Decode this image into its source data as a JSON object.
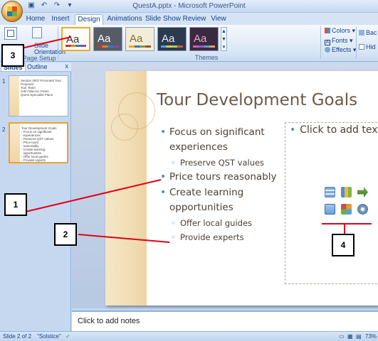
{
  "window": {
    "title": "QuestA.pptx - Microsoft PowerPoint",
    "qat_icons": [
      "save-icon",
      "undo-icon",
      "redo-icon",
      "customize-icon"
    ]
  },
  "tabs": [
    "Home",
    "Insert",
    "Design",
    "Animations",
    "Slide Show",
    "Review",
    "View"
  ],
  "active_tab": "Design",
  "ribbon": {
    "page_setup_group_label": "Page Setup",
    "slide_orientation_label": "Slide Orientation",
    "page_setup_label": "Page Setup",
    "themes_group_label": "Themes",
    "theme_thumb_text": "Aa",
    "colors_label": "Colors",
    "fonts_label": "Fonts",
    "effects_label": "Effects",
    "background_label": "Bac",
    "hide_label": "Hid"
  },
  "left_pane": {
    "tab_slides": "Slides",
    "tab_outline": "Outline",
    "close": "x",
    "thumbs": [
      {
        "num": "1",
        "text": "Section 2007 Promoted Tour\nProposal\nTour Team\nJohn Macron Green\nQuest Specialist Plans"
      },
      {
        "num": "2",
        "text": "Tour Development Goals\n- Focus on significant\n  experiences\n- Preserve QST values\n- Price tours\n  reasonably\n- Create learning\n  opportunities\n- Offer local guides\n- Provide experts"
      }
    ]
  },
  "slide": {
    "title": "Tour Development Goals",
    "bullets": [
      {
        "level": 1,
        "text": "Focus on significant experiences"
      },
      {
        "level": 2,
        "text": "Preserve QST values"
      },
      {
        "level": 1,
        "text": "Price tours reasonably"
      },
      {
        "level": 1,
        "text": "Create learning opportunities"
      },
      {
        "level": 2,
        "text": "Offer local guides"
      },
      {
        "level": 2,
        "text": "Provide experts"
      }
    ],
    "placeholder_text": "Click to add text",
    "placeholder_icons": [
      "insert-table-icon",
      "insert-chart-icon",
      "insert-smartart-icon",
      "insert-picture-icon",
      "insert-clipart-icon",
      "insert-media-icon"
    ]
  },
  "notes": {
    "placeholder": "Click to add notes"
  },
  "status": {
    "slide_count": "Slide 2 of 2",
    "theme": "\"Solstice\"",
    "zoom": "73%"
  },
  "callouts": [
    "1",
    "2",
    "3",
    "4"
  ],
  "colors": {
    "ribbon_bg": "#dbe7f6",
    "selected_theme_border": "#f2a825",
    "callout_line": "#e0001b",
    "slide_text": "#4b4035",
    "bullet_blue": "#4a8fbd"
  }
}
